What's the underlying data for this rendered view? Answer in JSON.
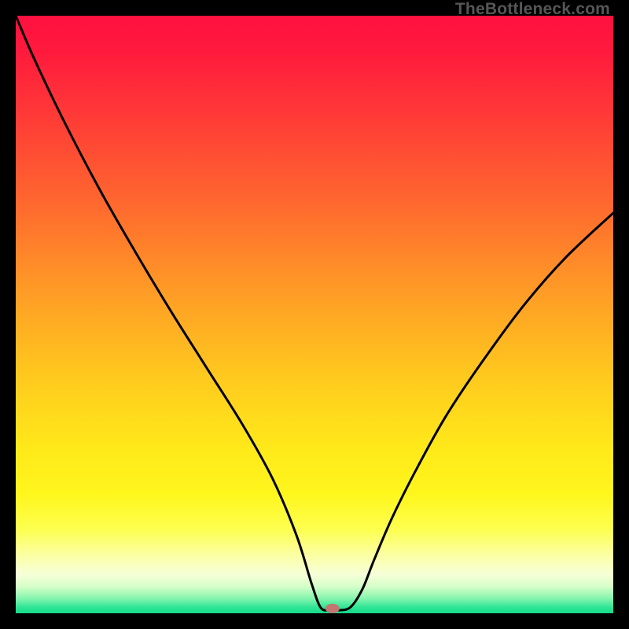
{
  "watermark": {
    "text": "TheBottleneck.com"
  },
  "chart_data": {
    "type": "line",
    "title": "",
    "xlabel": "",
    "ylabel": "",
    "xlim": [
      0,
      100
    ],
    "ylim": [
      0,
      100
    ],
    "gradient_stops": [
      {
        "offset": 0.0,
        "color": "#ff1040"
      },
      {
        "offset": 0.06,
        "color": "#ff1a3d"
      },
      {
        "offset": 0.18,
        "color": "#ff3e36"
      },
      {
        "offset": 0.32,
        "color": "#ff6a2e"
      },
      {
        "offset": 0.46,
        "color": "#ff9b26"
      },
      {
        "offset": 0.6,
        "color": "#ffc81e"
      },
      {
        "offset": 0.72,
        "color": "#ffe81a"
      },
      {
        "offset": 0.8,
        "color": "#fff61c"
      },
      {
        "offset": 0.86,
        "color": "#fdff50"
      },
      {
        "offset": 0.905,
        "color": "#fbffa8"
      },
      {
        "offset": 0.935,
        "color": "#f6ffd8"
      },
      {
        "offset": 0.955,
        "color": "#d6ffc8"
      },
      {
        "offset": 0.975,
        "color": "#86f5ae"
      },
      {
        "offset": 0.99,
        "color": "#2fe596"
      },
      {
        "offset": 1.0,
        "color": "#14db8a"
      }
    ],
    "series": [
      {
        "name": "bottleneck-curve",
        "x": [
          0.0,
          3.0,
          8.0,
          14.0,
          20.0,
          26.0,
          32.0,
          38.0,
          43.0,
          47.0,
          49.5,
          51.0,
          52.5,
          54.0,
          56.0,
          58.0,
          60.0,
          63.0,
          67.0,
          72.0,
          78.0,
          85.0,
          92.0,
          100.0
        ],
        "y": [
          100.0,
          93.0,
          82.5,
          71.0,
          60.5,
          50.5,
          41.0,
          31.5,
          22.5,
          13.0,
          5.0,
          1.0,
          0.5,
          0.5,
          1.0,
          4.0,
          9.0,
          16.0,
          24.0,
          33.0,
          42.0,
          51.5,
          59.5,
          67.0
        ]
      }
    ],
    "marker": {
      "x": 53.0,
      "y": 0.8,
      "color": "#c1766f",
      "rx": 9,
      "ry": 6
    },
    "annotations": []
  }
}
